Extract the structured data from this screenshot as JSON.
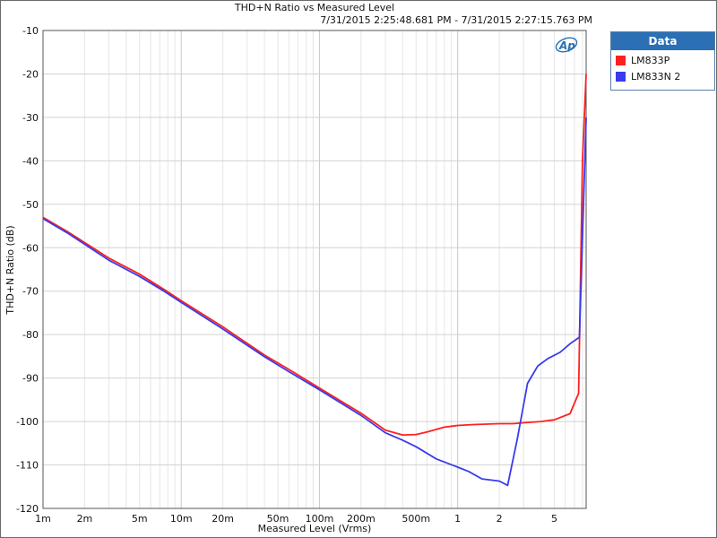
{
  "chart_data": {
    "type": "line",
    "title": "THD+N Ratio vs Measured Level",
    "subtitle": "7/31/2015 2:25:48.681 PM - 7/31/2015 2:27:15.763 PM",
    "xlabel": "Measured Level (Vrms)",
    "ylabel": "THD+N Ratio (dB)",
    "x_scale": "log",
    "xlim": [
      0.001,
      8.5
    ],
    "ylim": [
      -120,
      -10
    ],
    "grid": true,
    "legend_title": "Data",
    "legend_position": "right",
    "x_ticks": [
      {
        "v": 0.001,
        "label": "1m"
      },
      {
        "v": 0.002,
        "label": "2m"
      },
      {
        "v": 0.005,
        "label": "5m"
      },
      {
        "v": 0.01,
        "label": "10m"
      },
      {
        "v": 0.02,
        "label": "20m"
      },
      {
        "v": 0.05,
        "label": "50m"
      },
      {
        "v": 0.1,
        "label": "100m"
      },
      {
        "v": 0.2,
        "label": "200m"
      },
      {
        "v": 0.5,
        "label": "500m"
      },
      {
        "v": 1,
        "label": "1"
      },
      {
        "v": 2,
        "label": "2"
      },
      {
        "v": 5,
        "label": "5"
      }
    ],
    "y_ticks": [
      -10,
      -20,
      -30,
      -40,
      -50,
      -60,
      -70,
      -80,
      -90,
      -100,
      -110,
      -120
    ],
    "series": [
      {
        "name": "LM833P",
        "color": "#ff2020",
        "points": [
          [
            0.001,
            -53
          ],
          [
            0.0015,
            -56.3
          ],
          [
            0.002,
            -58.8
          ],
          [
            0.003,
            -62.4
          ],
          [
            0.005,
            -66.1
          ],
          [
            0.0075,
            -69.6
          ],
          [
            0.01,
            -72.2
          ],
          [
            0.02,
            -78.2
          ],
          [
            0.04,
            -84.7
          ],
          [
            0.06,
            -88.0
          ],
          [
            0.1,
            -92.3
          ],
          [
            0.2,
            -98.1
          ],
          [
            0.3,
            -102.0
          ],
          [
            0.4,
            -103.1
          ],
          [
            0.5,
            -103.0
          ],
          [
            0.6,
            -102.4
          ],
          [
            0.8,
            -101.3
          ],
          [
            1.0,
            -100.9
          ],
          [
            1.3,
            -100.7
          ],
          [
            2.0,
            -100.5
          ],
          [
            2.5,
            -100.5
          ],
          [
            3.0,
            -100.3
          ],
          [
            4.0,
            -100.0
          ],
          [
            5.0,
            -99.6
          ],
          [
            6.5,
            -98.2
          ],
          [
            7.5,
            -93.5
          ],
          [
            8.0,
            -40
          ],
          [
            8.5,
            -20
          ]
        ]
      },
      {
        "name": "LM833N 2",
        "color": "#3a3aee",
        "points": [
          [
            0.001,
            -53.3
          ],
          [
            0.0015,
            -56.6
          ],
          [
            0.002,
            -59.2
          ],
          [
            0.003,
            -62.9
          ],
          [
            0.005,
            -66.6
          ],
          [
            0.0075,
            -70.0
          ],
          [
            0.01,
            -72.6
          ],
          [
            0.02,
            -78.7
          ],
          [
            0.04,
            -85.1
          ],
          [
            0.06,
            -88.5
          ],
          [
            0.1,
            -92.7
          ],
          [
            0.2,
            -98.6
          ],
          [
            0.3,
            -102.6
          ],
          [
            0.4,
            -104.3
          ],
          [
            0.5,
            -105.8
          ],
          [
            0.7,
            -108.6
          ],
          [
            1.0,
            -110.5
          ],
          [
            1.2,
            -111.5
          ],
          [
            1.5,
            -113.2
          ],
          [
            2.0,
            -113.7
          ],
          [
            2.3,
            -114.7
          ],
          [
            2.7,
            -104.0
          ],
          [
            3.2,
            -91.2
          ],
          [
            3.8,
            -87.2
          ],
          [
            4.5,
            -85.5
          ],
          [
            5.5,
            -84.1
          ],
          [
            6.5,
            -82.1
          ],
          [
            7.6,
            -80.6
          ],
          [
            8.5,
            -30
          ]
        ]
      }
    ]
  }
}
